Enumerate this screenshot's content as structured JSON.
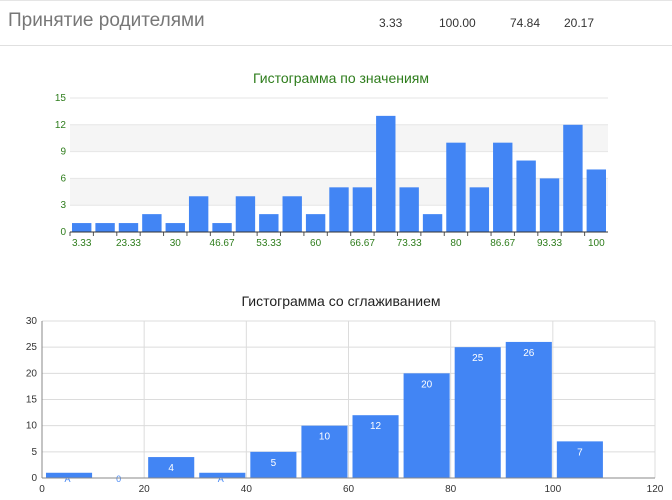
{
  "table_row": {
    "title": "Принятие родителями",
    "values": [
      "3.33",
      "100.00",
      "74.84",
      "20.17"
    ]
  },
  "chart_data": [
    {
      "type": "bar",
      "title": "Гистограмма по значениям",
      "categories": [
        "3.33",
        "",
        "23.33",
        "",
        "30",
        "",
        "46.67",
        "",
        "53.33",
        "",
        "60",
        "",
        "66.67",
        "",
        "73.33",
        "",
        "80",
        "",
        "86.67",
        "",
        "93.33",
        "",
        "100"
      ],
      "values": [
        1,
        1,
        1,
        2,
        1,
        4,
        1,
        4,
        2,
        4,
        2,
        5,
        5,
        13,
        5,
        2,
        10,
        5,
        10,
        8,
        6,
        12,
        7
      ],
      "ylim": [
        0,
        15
      ],
      "yticks": [
        0,
        3,
        6,
        9,
        12,
        15
      ],
      "grid": true,
      "bar_color": "#4285f4",
      "text_color": "#2e7d1c"
    },
    {
      "type": "bar",
      "title": "Гистограмма со сглаживанием",
      "bins": [
        {
          "x0": 0,
          "x1": 10,
          "value": 1,
          "label": ""
        },
        {
          "x0": 20,
          "x1": 30,
          "value": 4,
          "label": "4"
        },
        {
          "x0": 30,
          "x1": 40,
          "value": 1,
          "label": ""
        },
        {
          "x0": 40,
          "x1": 50,
          "value": 5,
          "label": "5"
        },
        {
          "x0": 50,
          "x1": 60,
          "value": 10,
          "label": "10"
        },
        {
          "x0": 60,
          "x1": 70,
          "value": 12,
          "label": "12"
        },
        {
          "x0": 70,
          "x1": 80,
          "value": 20,
          "label": "20"
        },
        {
          "x0": 80,
          "x1": 90,
          "value": 25,
          "label": "25"
        },
        {
          "x0": 90,
          "x1": 100,
          "value": 26,
          "label": "26"
        },
        {
          "x0": 100,
          "x1": 110,
          "value": 7,
          "label": "7"
        }
      ],
      "xlim": [
        0,
        120
      ],
      "ylim": [
        0,
        30
      ],
      "xticks": [
        0,
        20,
        40,
        60,
        80,
        100,
        120
      ],
      "yticks": [
        0,
        5,
        10,
        15,
        20,
        25,
        30
      ],
      "grid": true,
      "bar_color": "#4285f4",
      "rug_labels": [
        {
          "x": 5,
          "text": "A"
        },
        {
          "x": 15,
          "text": "0"
        },
        {
          "x": 35,
          "text": "A"
        }
      ]
    }
  ]
}
